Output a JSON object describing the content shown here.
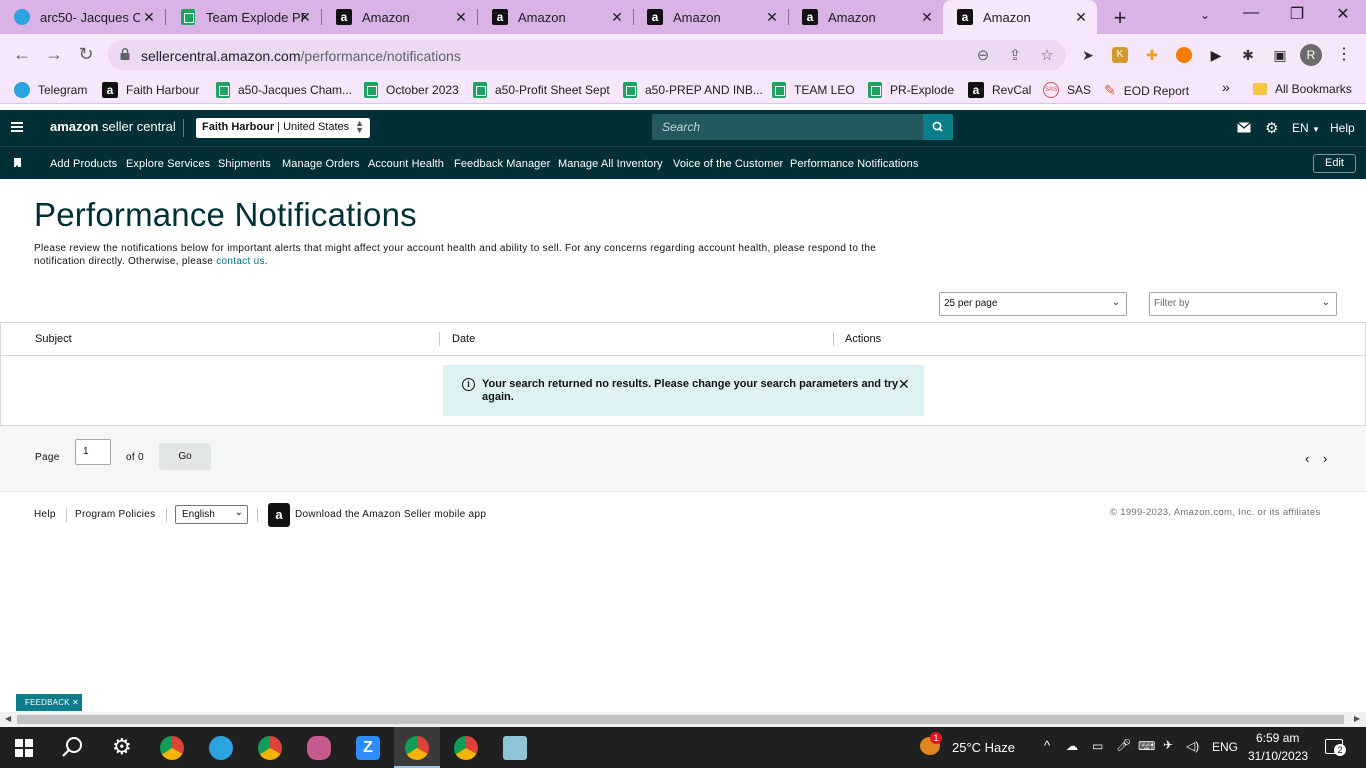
{
  "browser": {
    "tabs": [
      {
        "title": "arc50- Jacques C",
        "icon": "telegram-icon"
      },
      {
        "title": "Team Explode PF",
        "icon": "sheets-icon"
      },
      {
        "title": "Amazon",
        "icon": "amazon-icon"
      },
      {
        "title": "Amazon",
        "icon": "amazon-icon"
      },
      {
        "title": "Amazon",
        "icon": "amazon-icon"
      },
      {
        "title": "Amazon",
        "icon": "amazon-icon"
      },
      {
        "title": "Amazon",
        "icon": "amazon-icon",
        "active": true
      }
    ],
    "url_host": "sellercentral.amazon.com",
    "url_path": "/performance/notifications",
    "profile_initial": "R",
    "bookmarks": [
      {
        "label": "Telegram",
        "icon": "telegram-icon"
      },
      {
        "label": "Faith Harbour",
        "icon": "amazon-icon"
      },
      {
        "label": "a50-Jacques Cham...",
        "icon": "sheets-icon"
      },
      {
        "label": "October 2023",
        "icon": "sheets-icon"
      },
      {
        "label": "a50-Profit Sheet Sept",
        "icon": "sheets-icon"
      },
      {
        "label": "a50-PREP AND INB...",
        "icon": "sheets-icon"
      },
      {
        "label": "TEAM LEO",
        "icon": "sheets-icon"
      },
      {
        "label": "PR-Explode",
        "icon": "sheets-icon"
      },
      {
        "label": "RevCal",
        "icon": "amazon-icon"
      },
      {
        "label": "SAS",
        "icon": "sas-icon"
      },
      {
        "label": "EOD Report",
        "icon": "pen-icon"
      }
    ],
    "all_bookmarks": "All Bookmarks",
    "overflow": "»"
  },
  "header": {
    "logo_bold": "amazon",
    "logo_light": " seller central",
    "account_name": "Faith Harbour",
    "account_region": " | United States",
    "search_placeholder": "Search",
    "language": "EN",
    "help": "Help"
  },
  "nav": {
    "links": [
      "Add Products",
      "Explore Services",
      "Shipments",
      "Manage Orders",
      "Account Health",
      "Feedback Manager",
      "Manage All Inventory",
      "Voice of the Customer",
      "Performance Notifications"
    ],
    "edit": "Edit"
  },
  "main": {
    "title": "Performance Notifications",
    "description_1": "Please review the notifications below for important alerts that might affect your account health and ability to sell. For any concerns regarding account health, please respond to the notification directly. Otherwise, please ",
    "contact_link": "contact us",
    "description_2": ".",
    "per_page": "25 per page",
    "filter_placeholder": "Filter by",
    "columns": [
      "Subject",
      "Date",
      "Actions"
    ],
    "alert_message": "Your search returned no results. Please change your search parameters and try again."
  },
  "pagination": {
    "page_label": "Page",
    "page_value": "1",
    "of_label": "of 0",
    "go": "Go"
  },
  "footer": {
    "help": "Help",
    "program_policies": "Program Policies",
    "language": "English",
    "app_text": "Download the Amazon Seller mobile app",
    "copyright": "© 1999-2023, Amazon.com, Inc. or its affiliates"
  },
  "feedback": "FEEDBACK",
  "taskbar": {
    "weather_badge": "1",
    "weather": "25°C  Haze",
    "lang": "ENG",
    "time": "6:59 am",
    "date": "31/10/2023",
    "notifications": "2"
  },
  "colors": {
    "header_bg": "#002f36",
    "accent": "#087e8b",
    "link": "#007185",
    "tabstrip": "#d9b3e6"
  }
}
